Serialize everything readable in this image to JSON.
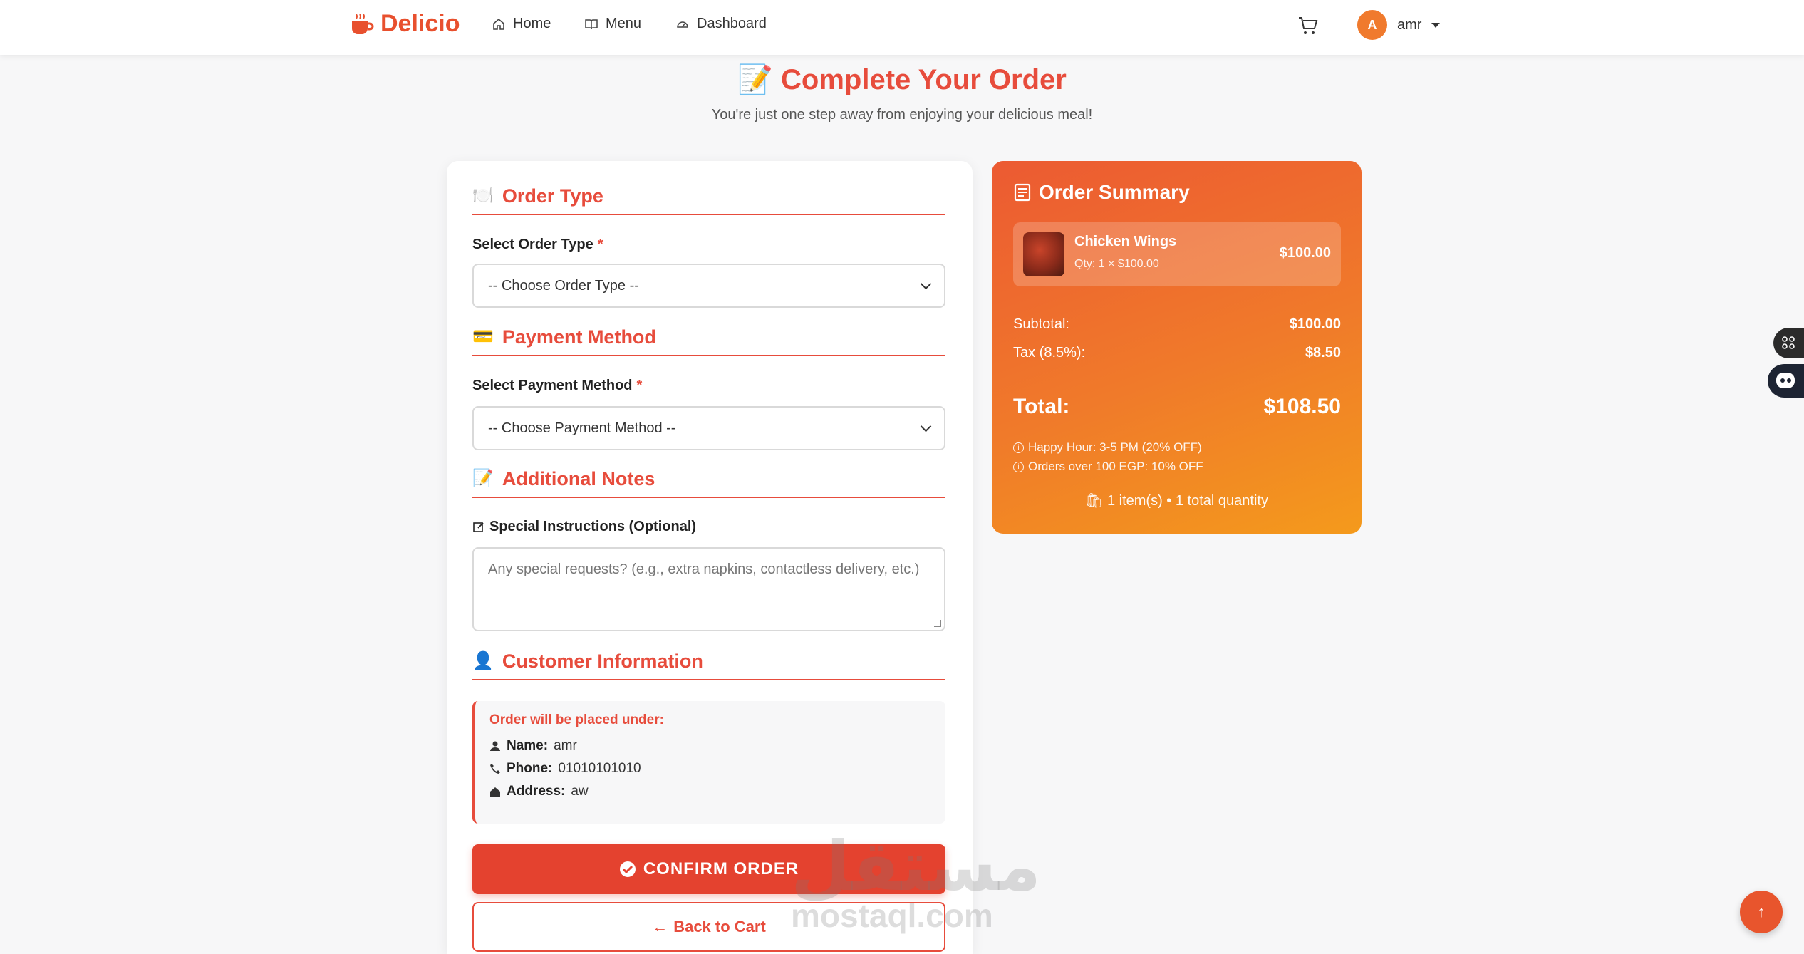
{
  "nav": {
    "brand": "Delicio",
    "links": [
      {
        "label": "Home",
        "icon": "home-icon"
      },
      {
        "label": "Menu",
        "icon": "book-icon"
      },
      {
        "label": "Dashboard",
        "icon": "dashboard-icon"
      }
    ],
    "user": {
      "initial": "A",
      "name": "amr"
    }
  },
  "header": {
    "title": "Complete Your Order",
    "subtitle": "You're just one step away from enjoying your delicious meal!"
  },
  "form": {
    "order_type": {
      "heading": "Order Type",
      "label": "Select Order Type",
      "required_mark": "*",
      "selected": "-- Choose Order Type --"
    },
    "payment": {
      "heading": "Payment Method",
      "label": "Select Payment Method",
      "required_mark": "*",
      "selected": "-- Choose Payment Method --"
    },
    "notes": {
      "heading": "Additional Notes",
      "label": "Special Instructions (Optional)",
      "placeholder": "Any special requests? (e.g., extra napkins, contactless delivery, etc.)"
    },
    "customer": {
      "heading": "Customer Information",
      "box_title": "Order will be placed under:",
      "name_label": "Name:",
      "name": "amr",
      "phone_label": "Phone:",
      "phone": "01010101010",
      "address_label": "Address:",
      "address": "aw"
    },
    "confirm_label": "CONFIRM ORDER",
    "back_label": "Back to Cart"
  },
  "summary": {
    "title": "Order Summary",
    "items": [
      {
        "name": "Chicken Wings",
        "qty_line": "Qty: 1 × $100.00",
        "price": "$100.00"
      }
    ],
    "subtotal_label": "Subtotal:",
    "subtotal": "$100.00",
    "tax_label": "Tax (8.5%):",
    "tax": "$8.50",
    "total_label": "Total:",
    "total": "$108.50",
    "notes": [
      "Happy Hour: 3-5 PM (20% OFF)",
      "Orders over 100 EGP: 10% OFF"
    ],
    "count_line": "1 item(s) • 1 total quantity"
  },
  "watermark": {
    "arabic": "مستقل",
    "latin": "mostaql.com"
  },
  "colors": {
    "accent": "#e74c3c",
    "brand": "#e8502e",
    "summary_start": "#ec5a32",
    "summary_end": "#f49a1c"
  }
}
